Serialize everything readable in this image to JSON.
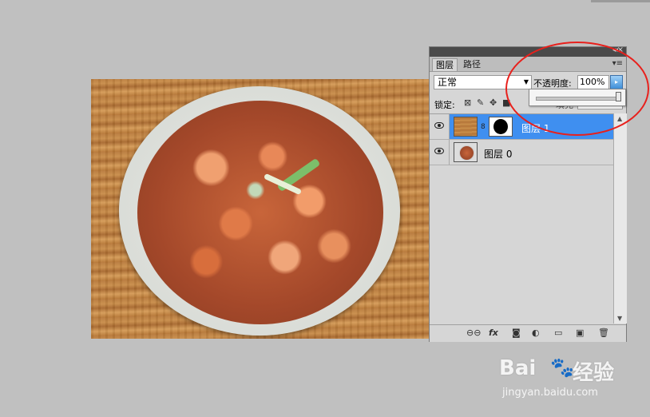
{
  "layers_panel": {
    "tabs": [
      {
        "label": "图层"
      },
      {
        "label": "路径"
      }
    ],
    "blend_mode": "正常",
    "opacity_label": "不透明度:",
    "opacity_value": "100%",
    "opacity_slider_value": 1.0,
    "lock_label": "锁定:",
    "fill_label": "填充",
    "layers": [
      {
        "name": "图层 1",
        "selected": true,
        "visible": true,
        "has_mask": true
      },
      {
        "name": "图层 0",
        "selected": false,
        "visible": true,
        "has_mask": false
      }
    ],
    "bottom_icons": [
      "link-icon",
      "fx-icon",
      "mask-icon",
      "adjustment-icon",
      "group-icon",
      "new-layer-icon",
      "trash-icon"
    ]
  },
  "annotation": {
    "color": "#e8201c"
  },
  "watermark": {
    "logo": "Bai",
    "logo_suffix": "经验",
    "url": "jingyan.baidu.com"
  },
  "colors": {
    "background": "#c0c0c0",
    "selected_layer": "#3f8ff0",
    "panel": "#d6d6d6"
  }
}
